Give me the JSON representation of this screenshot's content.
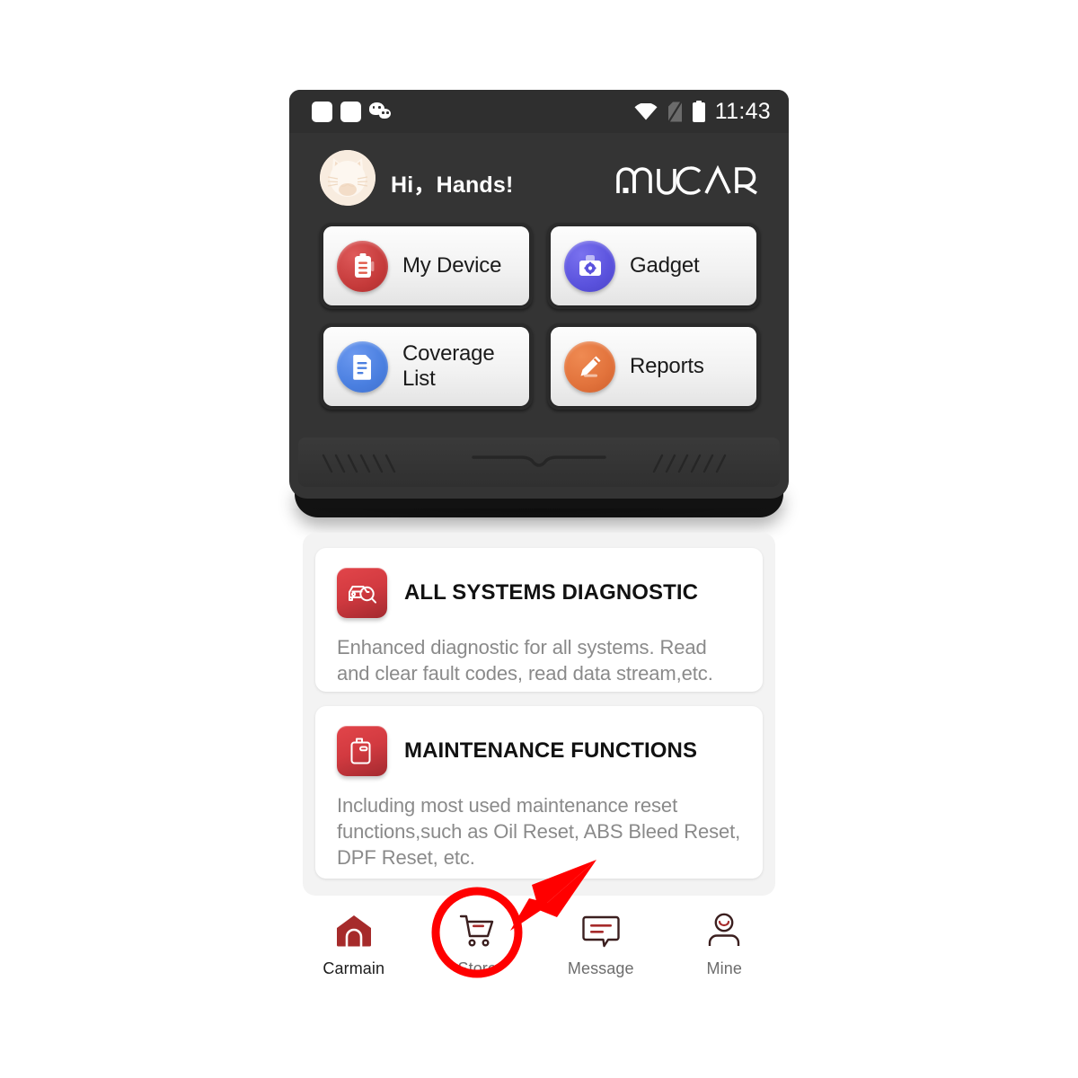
{
  "statusbar": {
    "icons": [
      "notification-square",
      "notification-square",
      "wechat-icon"
    ],
    "wifi": "wifi-icon",
    "sim": "sim-no-card-icon",
    "battery": "battery-full-icon",
    "time": "11:43"
  },
  "header": {
    "avatar": "cat-avatar",
    "greeting": "Hi，Hands!",
    "brand": "MUCAR"
  },
  "tiles": [
    {
      "label": "My Device",
      "icon": "device-clipboard-icon",
      "color": "#cf4040"
    },
    {
      "label": "Gadget",
      "icon": "toolbox-gear-icon",
      "color": "#5b55d8"
    },
    {
      "label": "Coverage List",
      "icon": "document-list-icon",
      "color": "#4a7fe0"
    },
    {
      "label": "Reports",
      "icon": "pencil-edit-icon",
      "color": "#e2733c"
    }
  ],
  "cards": [
    {
      "icon": "car-scan-icon",
      "title": "ALL SYSTEMS DIAGNOSTIC",
      "desc": "Enhanced diagnostic for all systems. Read and clear fault codes, read data stream,etc."
    },
    {
      "icon": "oil-can-icon",
      "title": "MAINTENANCE FUNCTIONS",
      "desc": "Including most used maintenance reset functions,such as Oil Reset, ABS Bleed Reset, DPF Reset, etc."
    }
  ],
  "bottom_nav": [
    {
      "label": "Carmain",
      "icon": "home-icon",
      "active": true
    },
    {
      "label": "Store",
      "icon": "cart-icon",
      "active": false
    },
    {
      "label": "Message",
      "icon": "message-icon",
      "active": false
    },
    {
      "label": "Mine",
      "icon": "person-icon",
      "active": false
    }
  ],
  "annotation": {
    "type": "red-circle-arrow",
    "target": "Store",
    "color": "#FF0000"
  },
  "colors": {
    "device_body": "#343434",
    "statusbar": "#2f2f2f",
    "card_bg": "#ffffff",
    "pane_bg": "#f3f3f3",
    "accent_red": "#a62b2b",
    "annotation_red": "#ff0000"
  }
}
